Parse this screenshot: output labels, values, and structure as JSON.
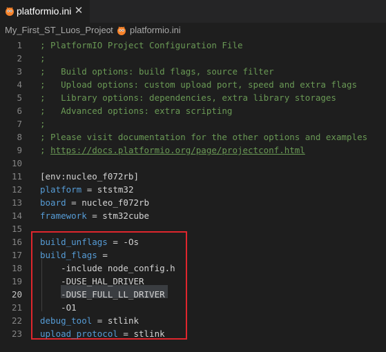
{
  "tab": {
    "label": "platformio.ini",
    "close_glyph": "✕",
    "icon": "platformio-icon"
  },
  "breadcrumb": {
    "folder": "My_First_ST_Luos_Project",
    "separator": "›",
    "file": "platformio.ini",
    "file_icon": "platformio-icon"
  },
  "editor": {
    "active_line": 20,
    "lines": [
      {
        "n": "1",
        "parts": [
          {
            "t": "; PlatformIO Project Configuration File",
            "c": "comment"
          }
        ]
      },
      {
        "n": "2",
        "parts": [
          {
            "t": ";",
            "c": "comment"
          }
        ]
      },
      {
        "n": "3",
        "parts": [
          {
            "t": ";   Build options: build flags, source filter",
            "c": "comment"
          }
        ]
      },
      {
        "n": "4",
        "parts": [
          {
            "t": ";   Upload options: custom upload port, speed and extra flags",
            "c": "comment"
          }
        ]
      },
      {
        "n": "5",
        "parts": [
          {
            "t": ";   Library options: dependencies, extra library storages",
            "c": "comment"
          }
        ]
      },
      {
        "n": "6",
        "parts": [
          {
            "t": ";   Advanced options: extra scripting",
            "c": "comment"
          }
        ]
      },
      {
        "n": "7",
        "parts": [
          {
            "t": ";",
            "c": "comment"
          }
        ]
      },
      {
        "n": "8",
        "parts": [
          {
            "t": "; Please visit documentation for the other options and examples",
            "c": "comment"
          }
        ]
      },
      {
        "n": "9",
        "parts": [
          {
            "t": "; ",
            "c": "comment"
          },
          {
            "t": "https://docs.platformio.org/page/projectconf.html",
            "c": "link"
          }
        ]
      },
      {
        "n": "10",
        "parts": []
      },
      {
        "n": "11",
        "parts": [
          {
            "t": "[env:nucleo_f072rb]",
            "c": "section"
          }
        ]
      },
      {
        "n": "12",
        "parts": [
          {
            "t": "platform",
            "c": "key"
          },
          {
            "t": " = ststm32",
            "c": "val"
          }
        ]
      },
      {
        "n": "13",
        "parts": [
          {
            "t": "board",
            "c": "key"
          },
          {
            "t": " = nucleo_f072rb",
            "c": "val"
          }
        ]
      },
      {
        "n": "14",
        "parts": [
          {
            "t": "framework",
            "c": "key"
          },
          {
            "t": " = stm32cube",
            "c": "val"
          }
        ]
      },
      {
        "n": "15",
        "parts": []
      },
      {
        "n": "16",
        "parts": [
          {
            "t": "build_unflags",
            "c": "key"
          },
          {
            "t": " = -Os",
            "c": "val"
          }
        ]
      },
      {
        "n": "17",
        "parts": [
          {
            "t": "build_flags",
            "c": "key"
          },
          {
            "t": " =",
            "c": "val"
          }
        ]
      },
      {
        "n": "18",
        "parts": [
          {
            "t": "    -include node_config.h",
            "c": "val"
          }
        ]
      },
      {
        "n": "19",
        "parts": [
          {
            "t": "    -DUSE_HAL_DRIVER",
            "c": "val"
          }
        ]
      },
      {
        "n": "20",
        "parts": [
          {
            "t": "    -DUSE_FULL_LL_DRIVER",
            "c": "val"
          }
        ]
      },
      {
        "n": "21",
        "parts": [
          {
            "t": "    -O1",
            "c": "val"
          }
        ]
      },
      {
        "n": "22",
        "parts": [
          {
            "t": "debug_tool",
            "c": "key"
          },
          {
            "t": " = stlink",
            "c": "val"
          }
        ]
      },
      {
        "n": "23",
        "parts": [
          {
            "t": "upload_protocol",
            "c": "key"
          },
          {
            "t": " = stlink",
            "c": "val"
          }
        ]
      }
    ]
  },
  "colors": {
    "background": "#1e1e1e",
    "comment": "#6a9955",
    "key": "#569cd6",
    "highlight_box": "#e0262d"
  }
}
